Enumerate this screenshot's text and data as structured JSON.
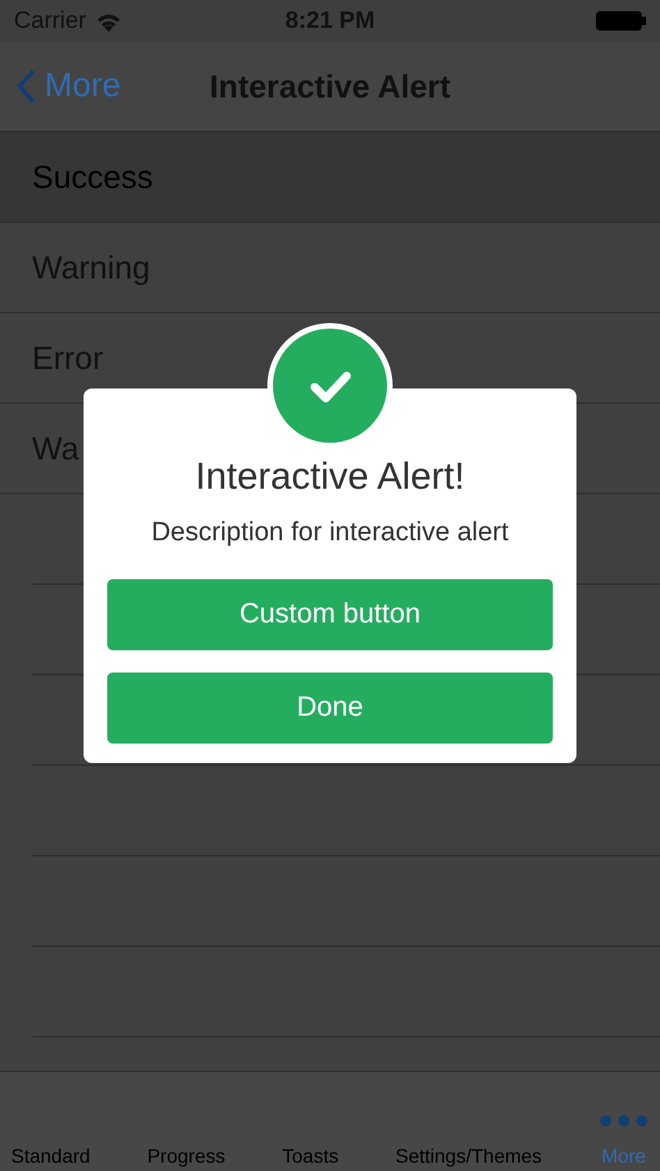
{
  "status_bar": {
    "carrier": "Carrier",
    "time": "8:21 PM"
  },
  "nav_bar": {
    "back": "More",
    "title": "Interactive Alert"
  },
  "list": {
    "items": [
      {
        "label": "Success",
        "selected": true
      },
      {
        "label": "Warning",
        "selected": false
      },
      {
        "label": "Error",
        "selected": false
      },
      {
        "label": "Wa",
        "selected": false
      }
    ]
  },
  "alert": {
    "title": "Interactive Alert!",
    "description": "Description for interactive alert",
    "buttons": [
      "Custom button",
      "Done"
    ]
  },
  "tab_bar": {
    "tabs": [
      {
        "label": "Standard",
        "selected": false
      },
      {
        "label": "Progress",
        "selected": false
      },
      {
        "label": "Toasts",
        "selected": false
      },
      {
        "label": "Settings/Themes",
        "selected": false
      },
      {
        "label": "More",
        "selected": true
      }
    ]
  }
}
